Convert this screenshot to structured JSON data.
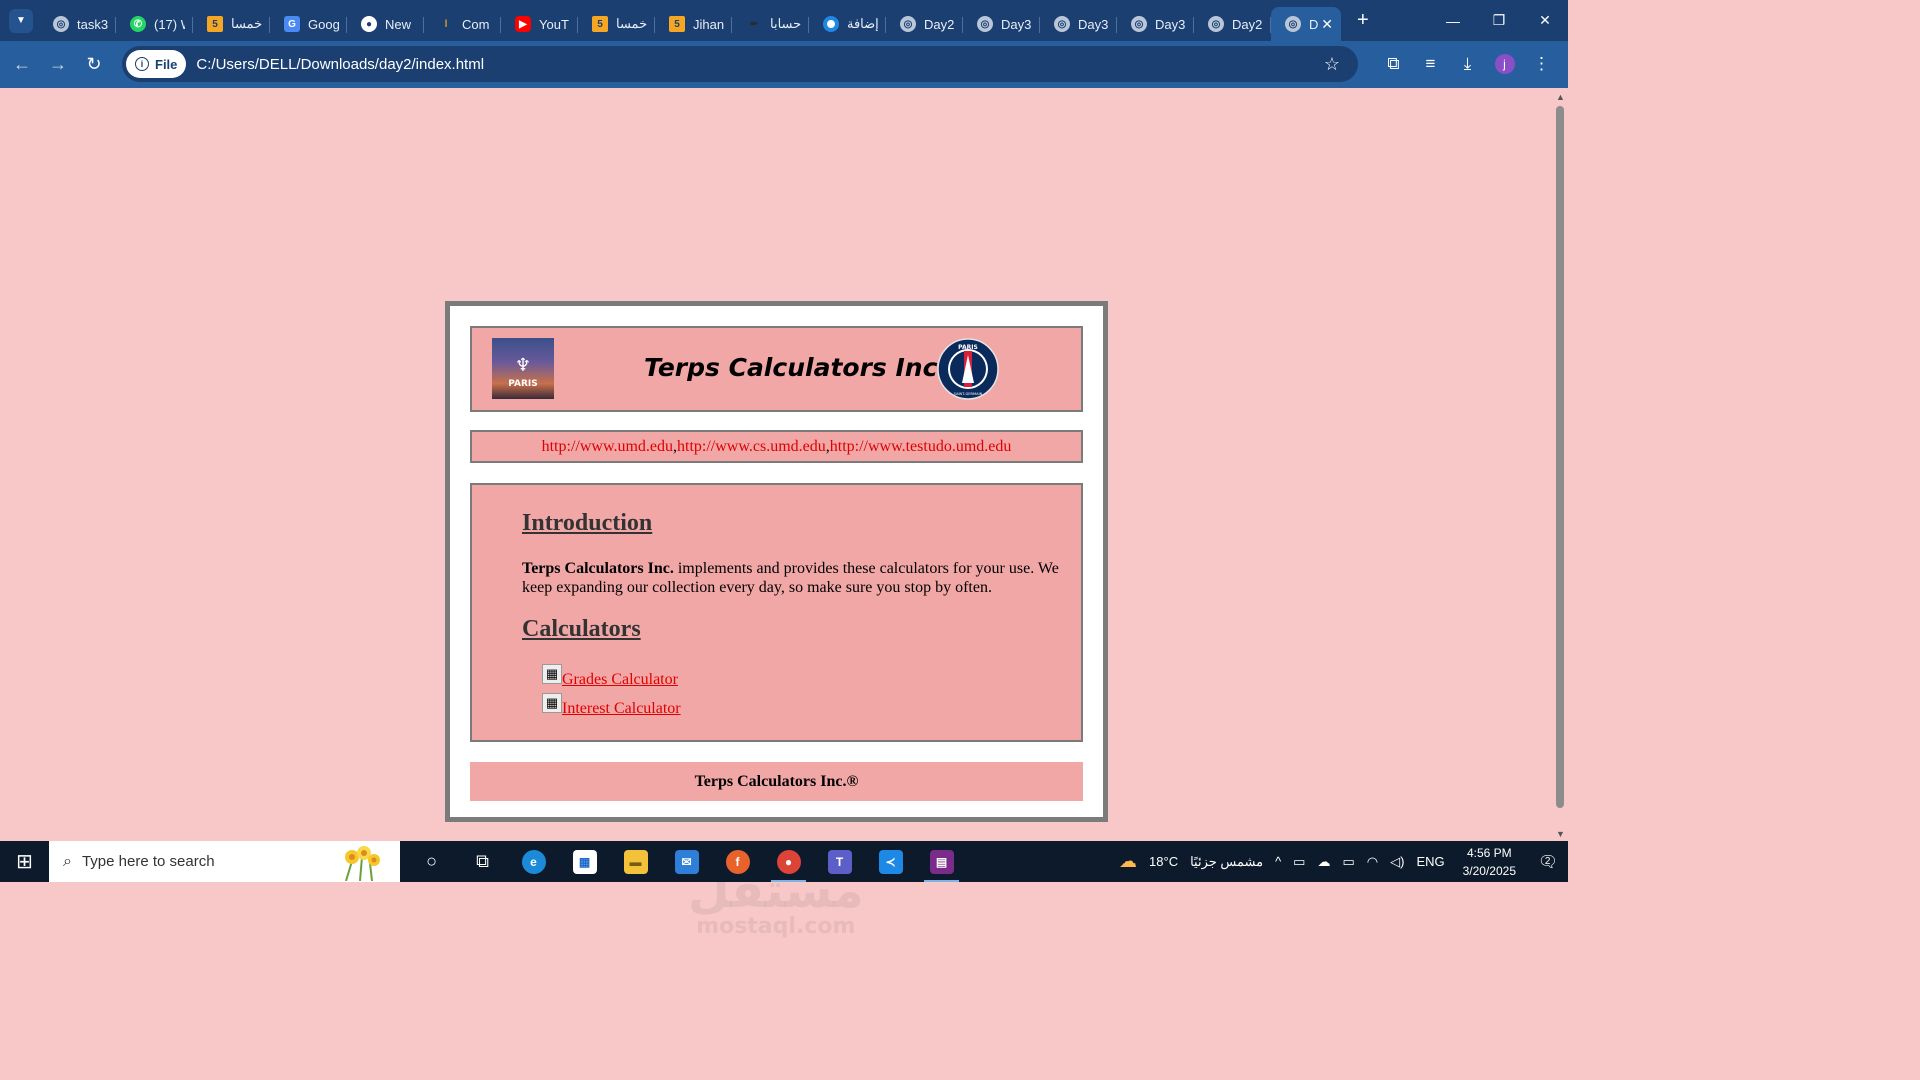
{
  "browser": {
    "tabs": [
      {
        "title": "task3",
        "icon": "globe-icon"
      },
      {
        "title": "(17) W",
        "icon": "whatsapp-icon"
      },
      {
        "title": "خمسا",
        "icon": "khamsat-icon"
      },
      {
        "title": "Goog",
        "icon": "google-translate-icon"
      },
      {
        "title": "New",
        "icon": "chrome-icon"
      },
      {
        "title": "Com",
        "icon": "candle-icon"
      },
      {
        "title": "YouT",
        "icon": "youtube-icon"
      },
      {
        "title": "خمسا",
        "icon": "khamsat-icon"
      },
      {
        "title": "Jihan",
        "icon": "khamsat-icon"
      },
      {
        "title": "حسابا",
        "icon": "feather-icon"
      },
      {
        "title": "إضافة",
        "icon": "ring-icon"
      },
      {
        "title": "Day2",
        "icon": "globe-icon"
      },
      {
        "title": "Day3",
        "icon": "globe-icon"
      },
      {
        "title": "Day3",
        "icon": "globe-icon"
      },
      {
        "title": "Day3",
        "icon": "globe-icon"
      },
      {
        "title": "Day2",
        "icon": "globe-icon"
      },
      {
        "title": "D",
        "icon": "globe-icon",
        "active": true
      }
    ],
    "address": {
      "chip_label": "File",
      "url": "C:/Users/DELL/Downloads/day2/index.html"
    },
    "colors": {
      "tabstrip": "#1a3f70",
      "toolbar": "#275e9e"
    }
  },
  "page": {
    "logo_text": "PARIS",
    "site_title": "Terps Calculators Inc.",
    "psg_logo_text": "PARIS SAINT-GERMAIN",
    "links": [
      "http://www.umd.edu",
      "http://www.cs.umd.edu",
      "http://www.testudo.umd.edu"
    ],
    "link_separator": ", ",
    "intro_heading": "Introduction",
    "intro_bold": "Terps Calculators Inc.",
    "intro_text": " implements and provides these calculators for your use. We keep expanding our collection every day, so make sure you stop by often.",
    "calc_heading": "Calculators",
    "calculators": [
      "Grades Calculator",
      "Interest Calculator"
    ],
    "footer": "Terps Calculators Inc.®",
    "colors": {
      "background": "#f8c8c8",
      "box": "#f2a7a7",
      "link": "#e00000",
      "border": "#7b7b7b"
    }
  },
  "watermark": {
    "arabic": "مستقل",
    "latin": "mostaql.com"
  },
  "taskbar": {
    "search_placeholder": "Type here to search",
    "weather_temp": "18°C",
    "weather_text": "مشمس جزئيًا",
    "language": "ENG",
    "time": "4:56 PM",
    "date": "3/20/2025",
    "notification_count": "2"
  }
}
